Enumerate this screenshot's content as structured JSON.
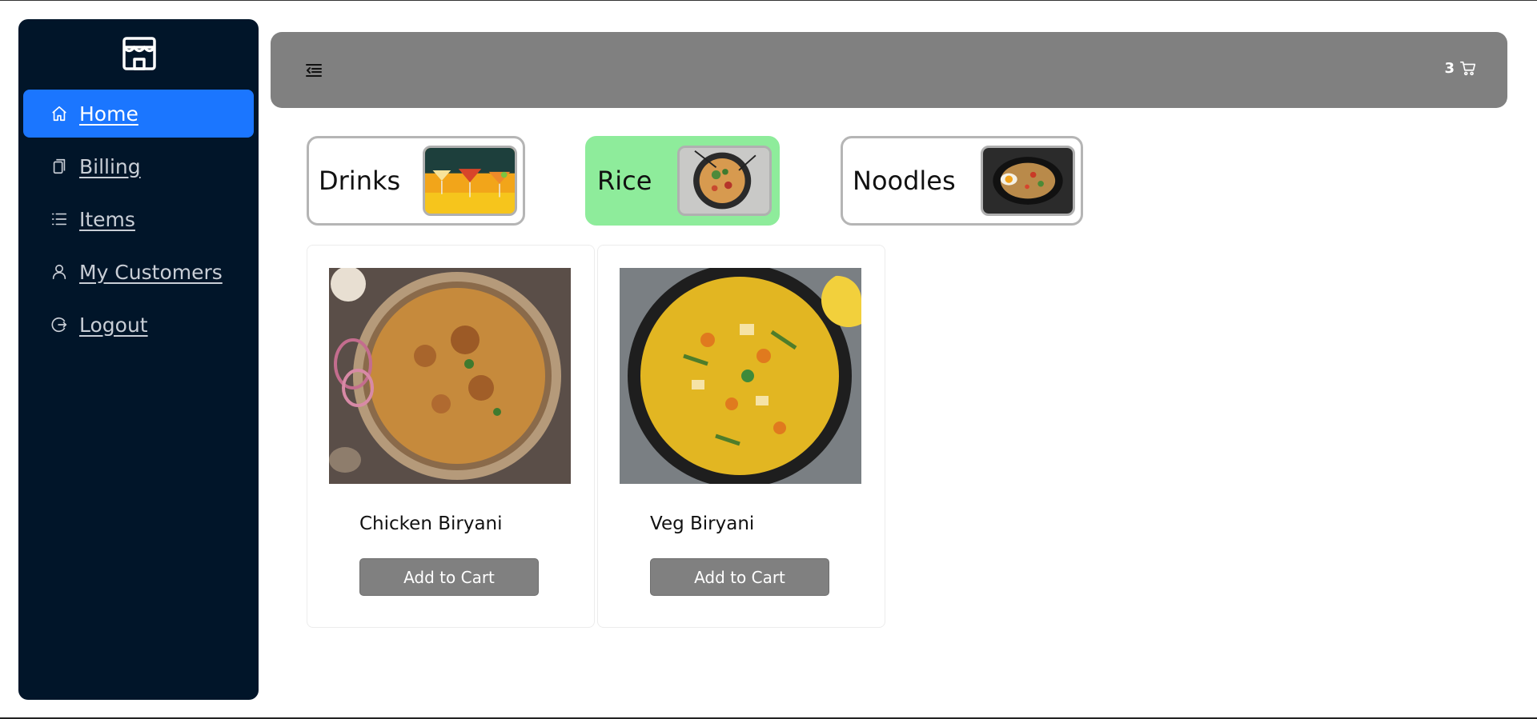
{
  "sidebar": {
    "logo_icon": "store-icon",
    "items": [
      {
        "label": "Home",
        "icon": "home-icon",
        "active": true
      },
      {
        "label": "Billing",
        "icon": "clipboard-icon"
      },
      {
        "label": "Items",
        "icon": "list-icon"
      },
      {
        "label": "My Customers",
        "icon": "user-icon"
      },
      {
        "label": "Logout",
        "icon": "logout-icon"
      }
    ]
  },
  "header": {
    "menu_icon": "menu-fold-icon",
    "cart_count": "3",
    "cart_icon": "cart-icon",
    "background": "#808080"
  },
  "categories": [
    {
      "label": "Drinks",
      "image": "cocktails-image"
    },
    {
      "label": "Rice",
      "image": "fried-rice-image",
      "active": true
    },
    {
      "label": "Noodles",
      "image": "noodles-image"
    }
  ],
  "products": [
    {
      "name": "Chicken Biryani",
      "image": "chicken-biryani-image",
      "button": "Add to Cart"
    },
    {
      "name": "Veg Biryani",
      "image": "veg-biryani-image",
      "button": "Add to Cart"
    }
  ],
  "colors": {
    "sidebar_bg": "#011529",
    "active_nav": "#1b76ff",
    "active_category": "#8eec9b",
    "button_bg": "#808080"
  }
}
